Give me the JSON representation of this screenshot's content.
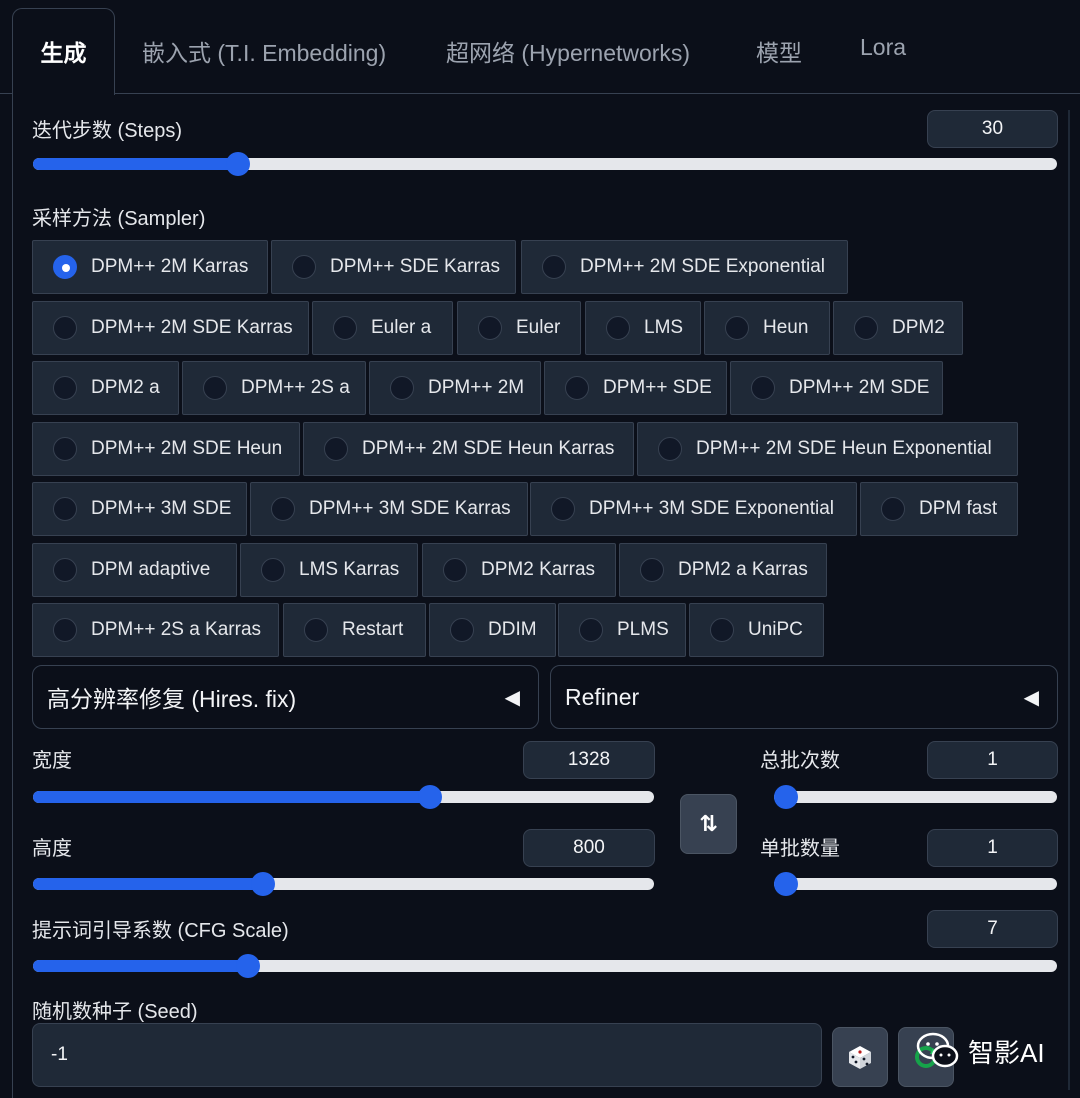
{
  "tabs": [
    {
      "label": "生成"
    },
    {
      "label": "嵌入式 (T.I. Embedding)"
    },
    {
      "label": "超网络 (Hypernetworks)"
    },
    {
      "label": "模型"
    },
    {
      "label": "Lora"
    }
  ],
  "steps": {
    "label": "迭代步数 (Steps)",
    "value": "30",
    "fraction": 0.2
  },
  "sampler": {
    "label": "采样方法 (Sampler)",
    "selected": "DPM++ 2M Karras",
    "options": [
      "DPM++ 2M Karras",
      "DPM++ SDE Karras",
      "DPM++ 2M SDE Exponential",
      "DPM++ 2M SDE Karras",
      "Euler a",
      "Euler",
      "LMS",
      "Heun",
      "DPM2",
      "DPM2 a",
      "DPM++ 2S a",
      "DPM++ 2M",
      "DPM++ SDE",
      "DPM++ 2M SDE",
      "DPM++ 2M SDE Heun",
      "DPM++ 2M SDE Heun Karras",
      "DPM++ 2M SDE Heun Exponential",
      "DPM++ 3M SDE",
      "DPM++ 3M SDE Karras",
      "DPM++ 3M SDE Exponential",
      "DPM fast",
      "DPM adaptive",
      "LMS Karras",
      "DPM2 Karras",
      "DPM2 a Karras",
      "DPM++ 2S a Karras",
      "Restart",
      "DDIM",
      "PLMS",
      "UniPC"
    ]
  },
  "hires": {
    "label": "高分辨率修复 (Hires. fix)",
    "caret": "◀"
  },
  "refiner": {
    "label": "Refiner",
    "caret": "◀"
  },
  "width": {
    "label": "宽度",
    "value": "1328",
    "fraction": 0.64
  },
  "height": {
    "label": "高度",
    "value": "800",
    "fraction": 0.37
  },
  "batch_count": {
    "label": "总批次数",
    "value": "1",
    "fraction": 0.0
  },
  "batch_size": {
    "label": "单批数量",
    "value": "1",
    "fraction": 0.0
  },
  "swap": {
    "glyph": "⇅"
  },
  "cfg": {
    "label": "提示词引导系数 (CFG Scale)",
    "value": "7",
    "fraction": 0.21
  },
  "seed": {
    "label": "随机数种子 (Seed)",
    "value": "-1"
  },
  "icons": {
    "dice": "dice-icon",
    "recycle": "recycle-icon"
  },
  "colors": {
    "accent": "#2563eb",
    "background": "#0b0f19",
    "surface": "#1f2937"
  },
  "watermark": {
    "text": "智影AI"
  }
}
